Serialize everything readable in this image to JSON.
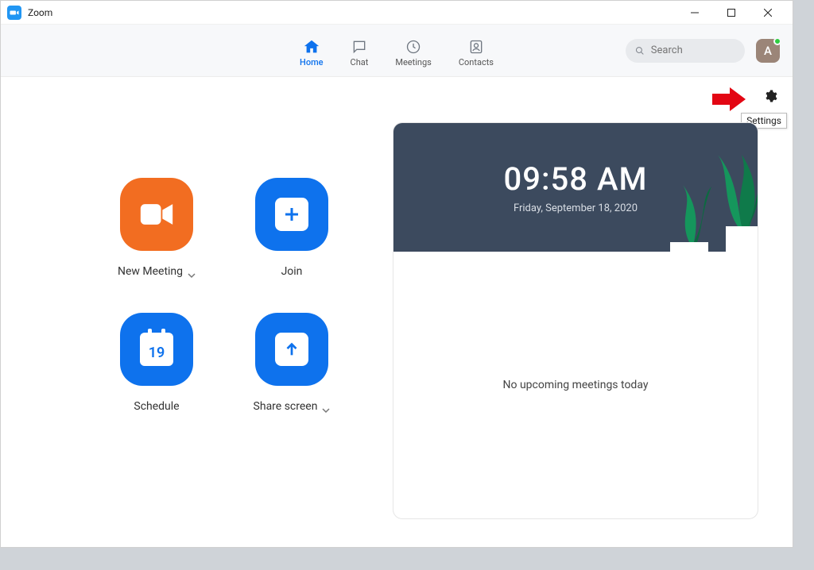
{
  "window": {
    "title": "Zoom"
  },
  "tabs": {
    "home": "Home",
    "chat": "Chat",
    "meetings": "Meetings",
    "contacts": "Contacts"
  },
  "search": {
    "placeholder": "Search"
  },
  "avatar": {
    "initial": "A"
  },
  "settings_tooltip": "Settings",
  "actions": {
    "new_meeting": "New Meeting",
    "join": "Join",
    "schedule": "Schedule",
    "share_screen": "Share screen",
    "schedule_day": "19"
  },
  "clock": {
    "time": "09:58 AM",
    "date": "Friday, September 18, 2020"
  },
  "upcoming": {
    "empty_text": "No upcoming meetings today"
  }
}
